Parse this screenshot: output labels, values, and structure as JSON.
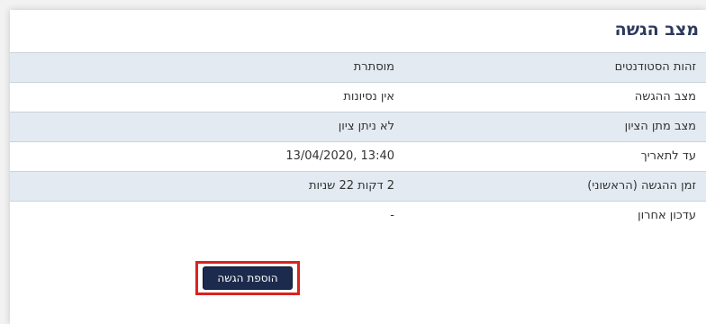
{
  "section": {
    "title": "מצב הגשה"
  },
  "rows": [
    {
      "label": "זהות הסטודנטים",
      "value": "מוסתרת"
    },
    {
      "label": "מצב ההגשה",
      "value": "אין נסיונות"
    },
    {
      "label": "מצב מתן הציון",
      "value": "לא ניתן ציון"
    },
    {
      "label": "עד לתאריך",
      "value": "13:40 ,13/04/2020"
    },
    {
      "label": "זמן ההגשה (הראשוני)",
      "value": "2 דקות 22 שניות"
    },
    {
      "label": "עדכון אחרון",
      "value": "-"
    }
  ],
  "actions": {
    "add_submission_label": "הוספת הגשה"
  },
  "colors": {
    "title": "#2b3a5c",
    "shaded_row": "#e3eaf1",
    "button_bg": "#1c2b4d",
    "highlight": "#d9231e"
  }
}
